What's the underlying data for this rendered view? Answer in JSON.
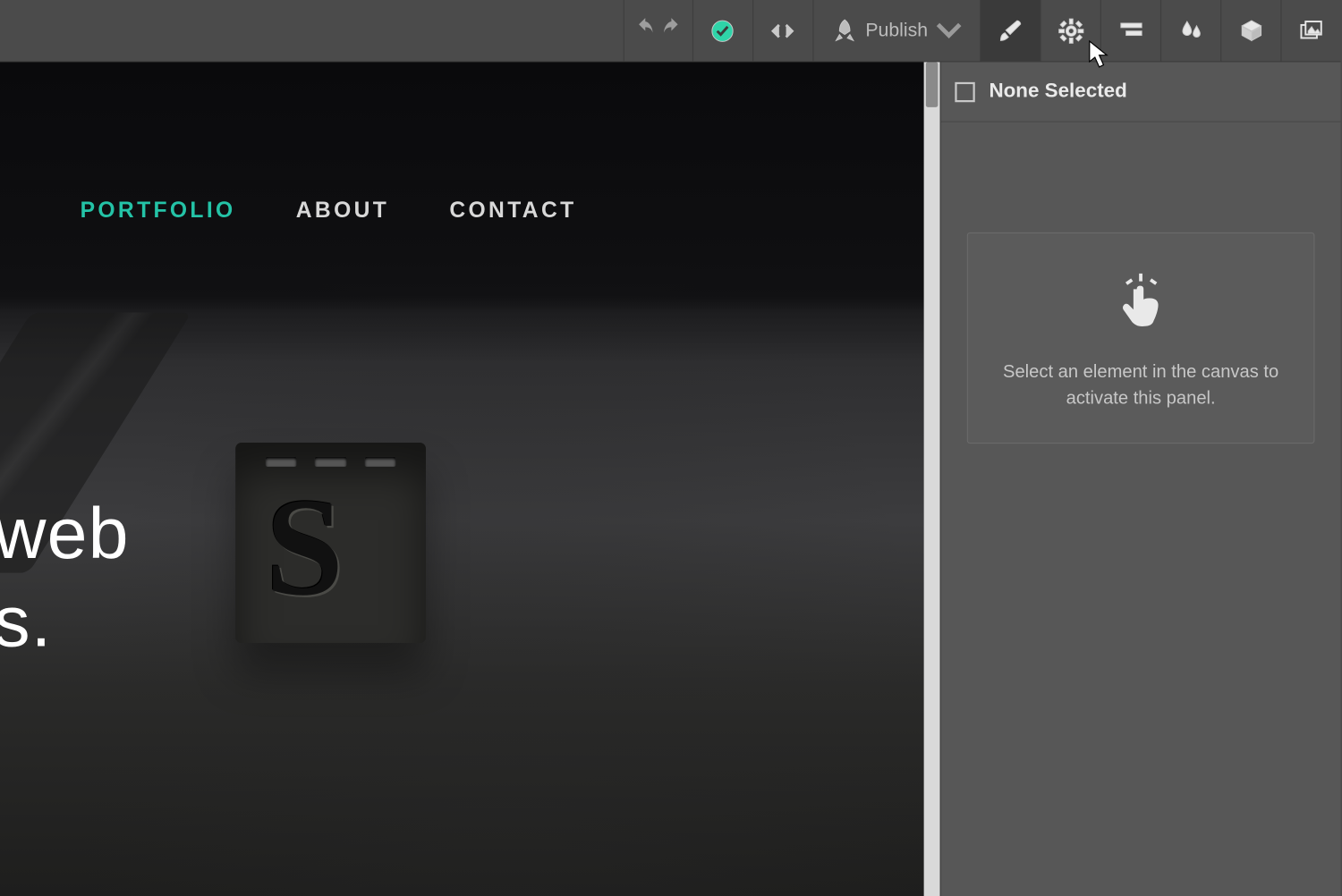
{
  "toolbar": {
    "publish_label": "Publish"
  },
  "nav": {
    "items": [
      {
        "label": "PORTFOLIO",
        "active": true
      },
      {
        "label": "ABOUT",
        "active": false
      },
      {
        "label": "CONTACT",
        "active": false
      }
    ]
  },
  "hero": {
    "line1": "web",
    "line2": "s."
  },
  "sidepanel": {
    "selection_label": "None Selected",
    "empty_hint": "Select an element in the canvas to activate this panel."
  }
}
